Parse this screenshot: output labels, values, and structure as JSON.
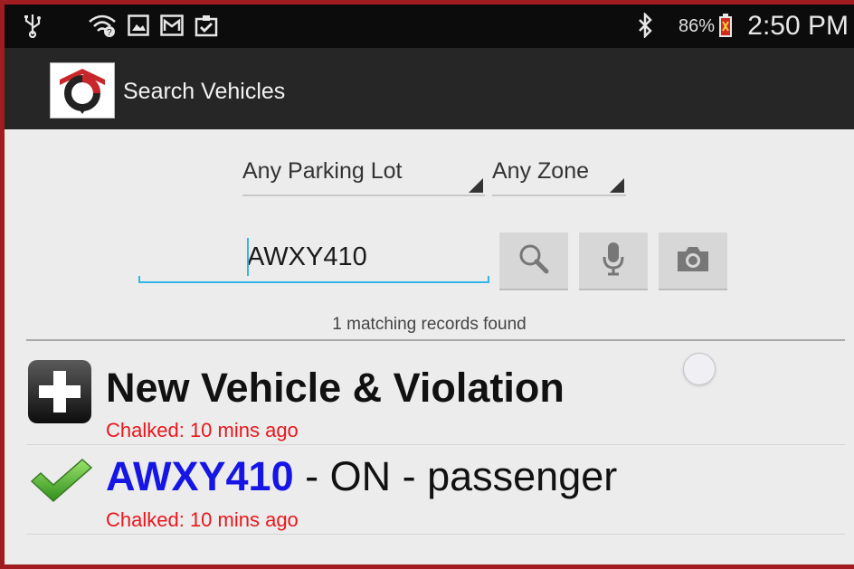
{
  "status_bar": {
    "time": "2:50 PM",
    "battery_percent": "86%",
    "icons": [
      "usb-icon",
      "wifi-icon",
      "gallery-icon",
      "gmail-icon",
      "clipboard-check-icon",
      "bluetooth-icon",
      "battery-icon"
    ]
  },
  "action_bar": {
    "title": "Search Vehicles",
    "logo_icon": "app-logo-icon"
  },
  "filters": {
    "parking_lot": "Any Parking Lot",
    "zone": "Any Zone"
  },
  "search": {
    "value": "AWXY410",
    "buttons": [
      "search-icon",
      "microphone-icon",
      "camera-icon"
    ]
  },
  "results": {
    "count_text": "1 matching records found",
    "items": [
      {
        "title": "New Vehicle & Violation",
        "subtitle": "Chalked: 10 mins ago",
        "icon": "plus-icon"
      },
      {
        "plate": "AWXY410",
        "details": " - ON - passenger",
        "subtitle": "Chalked: 10 mins ago",
        "icon": "checkmark-icon"
      }
    ]
  },
  "colors": {
    "frame_border": "#a01c20",
    "accent_blue": "#33b5e5",
    "plate_blue": "#1515e6",
    "chalked_red": "#e8171d"
  }
}
